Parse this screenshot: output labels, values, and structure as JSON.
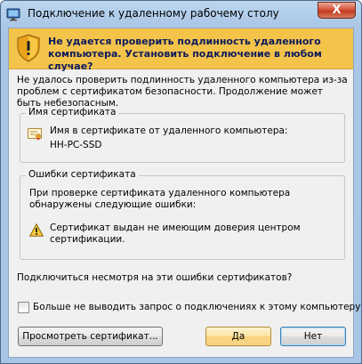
{
  "window": {
    "title": "Подключение к удаленному рабочему столу",
    "close_label": "X"
  },
  "banner": {
    "icon": "shield-warning-icon",
    "text": "Не удается проверить подлинность удаленного компьютера. Установить подключение в любом случае?"
  },
  "description": "Не удалось проверить подлинность удаленного компьютера из-за проблем с сертификатом безопасности. Продолжение может быть небезопасным.",
  "certificate_group": {
    "label": "Имя сертификата",
    "icon": "certificate-icon",
    "text": "Имя в сертификате от удаленного компьютера:",
    "name": "HH-PC-SSD"
  },
  "errors_group": {
    "label": "Ошибки сертификата",
    "intro": "При проверке сертификата удаленного компьютера обнаружены следующие ошибки:",
    "items": [
      {
        "icon": "warning-triangle-icon",
        "text": "Сертификат выдан не имеющим доверия центром сертификации."
      }
    ]
  },
  "question": "Подключиться несмотря на эти ошибки сертификатов?",
  "dont_ask_checkbox": {
    "label": "Больше не выводить запрос о подключениях к этому компьютеру",
    "checked": false
  },
  "buttons": {
    "view_cert": "Просмотреть сертификат...",
    "yes": "Да",
    "no": "Нет"
  },
  "colors": {
    "banner_bg": "#f3c34a",
    "banner_text": "#0d1b5e",
    "close_button": "#c23b1f"
  }
}
